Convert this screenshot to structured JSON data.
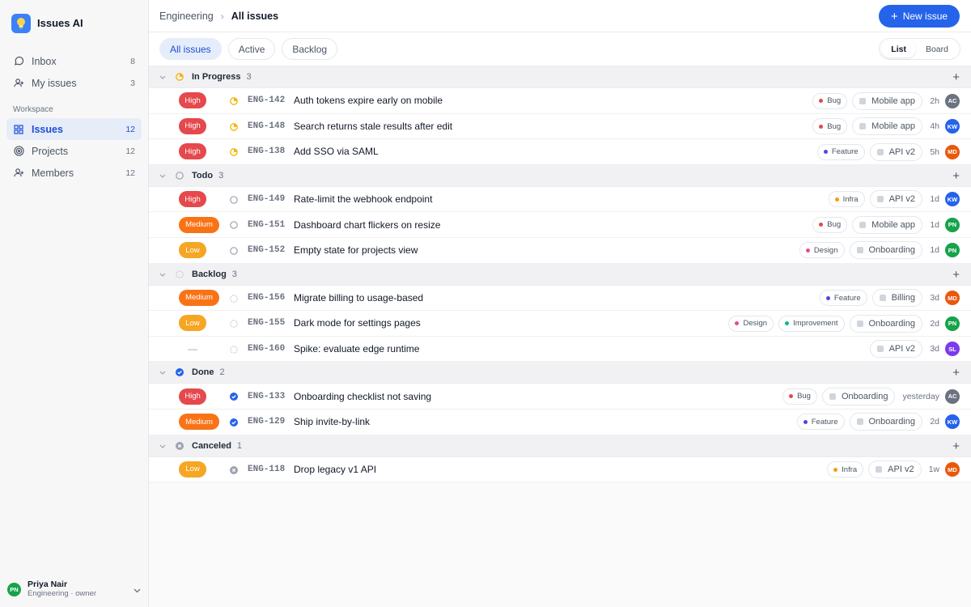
{
  "app": {
    "name": "Issues AI"
  },
  "sidebar": {
    "inbox": {
      "label": "Inbox",
      "count": "8"
    },
    "my_issues": {
      "label": "My issues",
      "count": "3"
    },
    "workspace_label": "Workspace",
    "issues": {
      "label": "Issues",
      "count": "12"
    },
    "projects": {
      "label": "Projects",
      "count": "12"
    },
    "members": {
      "label": "Members",
      "count": "12"
    }
  },
  "user": {
    "initials": "PN",
    "name": "Priya Nair",
    "role": "Engineering · owner"
  },
  "header": {
    "crumb": "Engineering",
    "current": "All issues",
    "new_issue": "New issue"
  },
  "tabs": {
    "all": "All issues",
    "active": "Active",
    "backlog": "Backlog"
  },
  "view": {
    "list": "List",
    "board": "Board"
  },
  "colors": {
    "accent": "#2563eb",
    "high": "#e5484d",
    "medium": "#f97316",
    "low": "#f5a623",
    "in_progress": "#f5b400",
    "done": "#2563eb"
  },
  "groups": [
    {
      "name": "In Progress",
      "count": "3",
      "status": "in-progress",
      "rows": [
        {
          "priority": "High",
          "id": "ENG-142",
          "title": "Auth tokens expire early on mobile",
          "labels": [
            {
              "text": "Bug",
              "color": "#e5484d"
            }
          ],
          "project": "Mobile app",
          "time": "2h",
          "av": "AC",
          "avc": "#6b7280"
        },
        {
          "priority": "High",
          "id": "ENG-148",
          "title": "Search returns stale results after edit",
          "labels": [
            {
              "text": "Bug",
              "color": "#e5484d"
            }
          ],
          "project": "Mobile app",
          "time": "4h",
          "av": "KW",
          "avc": "#2563eb"
        },
        {
          "priority": "High",
          "id": "ENG-138",
          "title": "Add SSO via SAML",
          "labels": [
            {
              "text": "Feature",
              "color": "#4f46e5"
            }
          ],
          "project": "API v2",
          "time": "5h",
          "av": "MD",
          "avc": "#ea580c"
        }
      ]
    },
    {
      "name": "Todo",
      "count": "3",
      "status": "todo",
      "rows": [
        {
          "priority": "High",
          "id": "ENG-149",
          "title": "Rate-limit the webhook endpoint",
          "labels": [
            {
              "text": "Infra",
              "color": "#f59e0b"
            }
          ],
          "project": "API v2",
          "time": "1d",
          "av": "KW",
          "avc": "#2563eb"
        },
        {
          "priority": "Medium",
          "id": "ENG-151",
          "title": "Dashboard chart flickers on resize",
          "labels": [
            {
              "text": "Bug",
              "color": "#e5484d"
            }
          ],
          "project": "Mobile app",
          "time": "1d",
          "av": "PN",
          "avc": "#16a34a"
        },
        {
          "priority": "Low",
          "id": "ENG-152",
          "title": "Empty state for projects view",
          "labels": [
            {
              "text": "Design",
              "color": "#ec4899"
            }
          ],
          "project": "Onboarding",
          "time": "1d",
          "av": "PN",
          "avc": "#16a34a"
        }
      ]
    },
    {
      "name": "Backlog",
      "count": "3",
      "status": "backlog",
      "rows": [
        {
          "priority": "Medium",
          "id": "ENG-156",
          "title": "Migrate billing to usage-based",
          "labels": [
            {
              "text": "Feature",
              "color": "#4f46e5"
            }
          ],
          "project": "Billing",
          "time": "3d",
          "av": "MD",
          "avc": "#ea580c"
        },
        {
          "priority": "Low",
          "id": "ENG-155",
          "title": "Dark mode for settings pages",
          "labels": [
            {
              "text": "Design",
              "color": "#ec4899"
            },
            {
              "text": "Improvement",
              "color": "#10b981"
            }
          ],
          "project": "Onboarding",
          "time": "2d",
          "av": "PN",
          "avc": "#16a34a"
        },
        {
          "priority": "—",
          "id": "ENG-160",
          "title": "Spike: evaluate edge runtime",
          "labels": [],
          "project": "API v2",
          "time": "3d",
          "av": "SL",
          "avc": "#7c3aed"
        }
      ]
    },
    {
      "name": "Done",
      "count": "2",
      "status": "done",
      "rows": [
        {
          "priority": "High",
          "id": "ENG-133",
          "title": "Onboarding checklist not saving",
          "labels": [
            {
              "text": "Bug",
              "color": "#e5484d"
            }
          ],
          "project": "Onboarding",
          "time": "yesterday",
          "av": "AC",
          "avc": "#6b7280"
        },
        {
          "priority": "Medium",
          "id": "ENG-129",
          "title": "Ship invite-by-link",
          "labels": [
            {
              "text": "Feature",
              "color": "#4f46e5"
            }
          ],
          "project": "Onboarding",
          "time": "2d",
          "av": "KW",
          "avc": "#2563eb"
        }
      ]
    },
    {
      "name": "Canceled",
      "count": "1",
      "status": "canceled",
      "rows": [
        {
          "priority": "Low",
          "id": "ENG-118",
          "title": "Drop legacy v1 API",
          "labels": [
            {
              "text": "Infra",
              "color": "#f59e0b"
            }
          ],
          "project": "API v2",
          "time": "1w",
          "av": "MD",
          "avc": "#ea580c"
        }
      ]
    }
  ]
}
